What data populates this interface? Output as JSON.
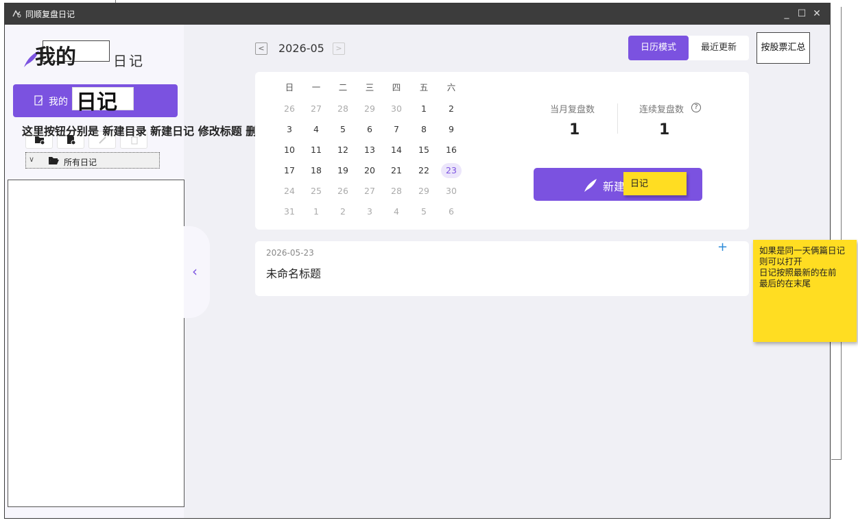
{
  "window": {
    "title": "同顺复盘日记"
  },
  "sidebar": {
    "logo_text": "日记",
    "logo_overlay": "我的",
    "my_diary_label": "我的",
    "diary_overlay": "日记",
    "toolbar_note": "这里按钮分别是 新建目录 新建日记  修改标题 删除",
    "tree": {
      "root_label": "所有日记"
    }
  },
  "header": {
    "month": "2026-05",
    "mode_calendar": "日历模式",
    "mode_recent": "最近更新",
    "stock_summary": "按股票汇总"
  },
  "calendar": {
    "weekdays": [
      "日",
      "一",
      "二",
      "三",
      "四",
      "五",
      "六"
    ],
    "weeks": [
      [
        [
          "26",
          0
        ],
        [
          "27",
          0
        ],
        [
          "28",
          0
        ],
        [
          "29",
          0
        ],
        [
          "30",
          0
        ],
        [
          "1",
          1
        ],
        [
          "2",
          1
        ]
      ],
      [
        [
          "3",
          1
        ],
        [
          "4",
          1
        ],
        [
          "5",
          1
        ],
        [
          "6",
          1
        ],
        [
          "7",
          1
        ],
        [
          "8",
          1
        ],
        [
          "9",
          1
        ]
      ],
      [
        [
          "10",
          1
        ],
        [
          "11",
          1
        ],
        [
          "12",
          1
        ],
        [
          "13",
          1
        ],
        [
          "14",
          1
        ],
        [
          "15",
          1
        ],
        [
          "16",
          1
        ]
      ],
      [
        [
          "17",
          1
        ],
        [
          "18",
          1
        ],
        [
          "19",
          1
        ],
        [
          "20",
          1
        ],
        [
          "21",
          1
        ],
        [
          "22",
          1
        ],
        [
          "23",
          2
        ]
      ],
      [
        [
          "24",
          0
        ],
        [
          "25",
          0
        ],
        [
          "26",
          0
        ],
        [
          "27",
          0
        ],
        [
          "28",
          0
        ],
        [
          "29",
          0
        ],
        [
          "30",
          0
        ]
      ],
      [
        [
          "31",
          0
        ],
        [
          "1",
          0
        ],
        [
          "2",
          0
        ],
        [
          "3",
          0
        ],
        [
          "4",
          0
        ],
        [
          "5",
          0
        ],
        [
          "6",
          0
        ]
      ]
    ]
  },
  "stats": {
    "monthly_label": "当月复盘数",
    "monthly_value": "1",
    "streak_label": "连续复盘数",
    "streak_value": "1",
    "help_symbol": "?"
  },
  "new_button": {
    "label": "新建",
    "sticky_note": "日记"
  },
  "entries": [
    {
      "date": "2026-05-23",
      "title": "未命名标题"
    }
  ],
  "side_note": {
    "plus": "+",
    "lines": [
      "如果是同一天俩篇日记",
      "则可以打开",
      "日记按照最新的在前",
      "最后的在末尾"
    ]
  },
  "colors": {
    "accent": "#7b52e0",
    "sticky": "#ffdd22",
    "titlebar": "#3c3c3c"
  }
}
